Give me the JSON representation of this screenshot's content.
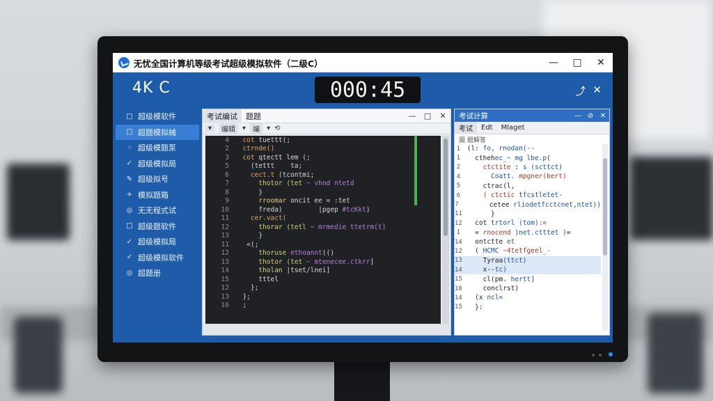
{
  "window": {
    "title": "无忧全国计算机等级考试超级模拟软件（二级C）",
    "controls": {
      "minimize": "—",
      "maximize": "□",
      "close": "✕"
    }
  },
  "header": {
    "level": "4K C",
    "timer": "000:45",
    "icons": {
      "upload": "⤴",
      "close": "✕"
    }
  },
  "sidebar": {
    "items": [
      {
        "label": "超级模软件",
        "icon": "□"
      },
      {
        "label": "超题模拟械",
        "icon": "□"
      },
      {
        "label": "超级模题泵",
        "icon": "⁘"
      },
      {
        "label": "超级模拟局",
        "icon": "✓"
      },
      {
        "label": "超级拟号",
        "icon": "✎"
      },
      {
        "label": "模拟题箱",
        "icon": "+"
      },
      {
        "label": "无无程式试",
        "icon": "◎"
      },
      {
        "label": "超级题软件",
        "icon": "□"
      },
      {
        "label": "超级模拟局",
        "icon": "✓"
      },
      {
        "label": "超级模拟软件",
        "icon": "✓"
      },
      {
        "label": "超题册",
        "icon": "◎"
      }
    ]
  },
  "editor": {
    "tabs": [
      "考试编试",
      "题题"
    ],
    "controls": {
      "minimize": "—",
      "maximize": "□",
      "close": "✕"
    },
    "toolbar": [
      "▾",
      "编辑",
      "▾",
      "编",
      "▾",
      "⟲"
    ],
    "lines": [
      {
        "n": "4",
        "segs": [
          {
            "c": "c-kw",
            "t": "  cot"
          },
          {
            "c": "c-plain",
            "t": " tuettt(;"
          }
        ]
      },
      {
        "n": "2",
        "segs": [
          {
            "c": "c-kw",
            "t": "  ctrnde()"
          }
        ]
      },
      {
        "n": "3",
        "segs": [
          {
            "c": "c-kw",
            "t": "  cot"
          },
          {
            "c": "c-plain",
            "t": " qtectt lem (;"
          }
        ]
      },
      {
        "n": "5",
        "segs": [
          {
            "c": "c-plain",
            "t": "    (tettt    ta;"
          }
        ]
      },
      {
        "n": "6",
        "segs": [
          {
            "c": "c-kw",
            "t": "    cect.t"
          },
          {
            "c": "c-plain",
            "t": " (tcontmi;"
          }
        ]
      },
      {
        "n": "7",
        "segs": [
          {
            "c": "c-fn",
            "t": "      thotor (tet"
          },
          {
            "c": "c-str",
            "t": " ~ vhnd ntetd"
          }
        ]
      },
      {
        "n": "8",
        "segs": [
          {
            "c": "c-plain",
            "t": "      }"
          }
        ]
      },
      {
        "n": "9",
        "segs": [
          {
            "c": "c-fn",
            "t": "      rroomar"
          },
          {
            "c": "c-plain",
            "t": " oncit ee = :tet"
          }
        ]
      },
      {
        "n": "10",
        "segs": [
          {
            "c": "c-plain",
            "t": "      freda)         |pgep "
          },
          {
            "c": "c-str",
            "t": "#tcKkt"
          },
          {
            "c": "c-plain",
            "t": ")"
          }
        ]
      },
      {
        "n": "11",
        "segs": [
          {
            "c": "c-kw",
            "t": "    cer.vact("
          }
        ]
      },
      {
        "n": "12",
        "segs": [
          {
            "c": "c-fn",
            "t": "      thorar (tetl"
          },
          {
            "c": "c-str",
            "t": " ~ mrmedie ttetrm(t]"
          }
        ]
      },
      {
        "n": "13",
        "segs": [
          {
            "c": "c-plain",
            "t": "      }"
          }
        ]
      },
      {
        "n": "11",
        "segs": [
          {
            "c": "c-plain",
            "t": "   <(;"
          }
        ]
      },
      {
        "n": "12",
        "segs": [
          {
            "c": "c-fn",
            "t": "      thoruse"
          },
          {
            "c": "c-str",
            "t": " ethoannt"
          },
          {
            "c": "c-plain",
            "t": "(()"
          }
        ]
      },
      {
        "n": "13",
        "segs": [
          {
            "c": "c-fn",
            "t": "      thotor (tet"
          },
          {
            "c": "c-str",
            "t": " ~ mtenecee.ctkrr"
          },
          {
            "c": "c-plain",
            "t": "]"
          }
        ]
      },
      {
        "n": "14",
        "segs": [
          {
            "c": "c-fn",
            "t": "      tholan"
          },
          {
            "c": "c-plain",
            "t": " |tset/lnei]"
          }
        ]
      },
      {
        "n": "15",
        "segs": [
          {
            "c": "c-plain",
            "t": "      tttel"
          }
        ]
      },
      {
        "n": "12",
        "segs": [
          {
            "c": "c-plain",
            "t": "    };"
          }
        ]
      },
      {
        "n": "13",
        "segs": [
          {
            "c": "c-plain",
            "t": "  };"
          }
        ]
      },
      {
        "n": "16",
        "segs": [
          {
            "c": "c-plain",
            "t": "  ;"
          }
        ]
      }
    ]
  },
  "answer_pane": {
    "title": "考试计算",
    "controls": {
      "minimize": "—",
      "maximize": "⊘",
      "close": "✕"
    },
    "tabs": [
      "考试",
      "Edt",
      "Mlaget"
    ],
    "subheader": "国 题解答",
    "lines": [
      {
        "n": "1",
        "hl": false,
        "segs": [
          {
            "c": "r-dark",
            "t": " (l:"
          },
          {
            "c": "r-blue",
            "t": " fo, rnodan(--"
          }
        ]
      },
      {
        "n": "1",
        "hl": false,
        "segs": [
          {
            "c": "r-dark",
            "t": "   ctheh"
          },
          {
            "c": "r-blue",
            "t": "ec_~ mg lbe.p"
          },
          {
            "c": "r-dark",
            "t": "("
          }
        ]
      },
      {
        "n": "2",
        "hl": false,
        "segs": [
          {
            "c": "r-red",
            "t": "     ctctite"
          },
          {
            "c": "r-dark",
            "t": " : "
          },
          {
            "c": "r-blue",
            "t": "s (scttct)"
          }
        ]
      },
      {
        "n": "4",
        "hl": false,
        "segs": [
          {
            "c": "r-blue",
            "t": "       Coatt."
          },
          {
            "c": "r-red",
            "t": " mpgner(bert)"
          }
        ]
      },
      {
        "n": "5",
        "hl": false,
        "segs": [
          {
            "c": "r-dark",
            "t": "     ctrac(l,"
          }
        ]
      },
      {
        "n": "6",
        "hl": false,
        "segs": [
          {
            "c": "r-red",
            "t": "     ( ctctic"
          },
          {
            "c": "r-blue",
            "t": " tfcstletet-"
          }
        ]
      },
      {
        "n": "7",
        "hl": false,
        "segs": [
          {
            "c": "r-dark",
            "t": "       cetee"
          },
          {
            "c": "r-blue",
            "t": " rliodetfcctcnet,ntet))"
          }
        ]
      },
      {
        "n": "11",
        "hl": false,
        "segs": [
          {
            "c": "r-dark",
            "t": "       }"
          }
        ]
      },
      {
        "n": "12",
        "hl": false,
        "segs": [
          {
            "c": "r-dark",
            "t": "   cot"
          },
          {
            "c": "r-blue",
            "t": " trtorl (tom)"
          },
          {
            "c": "r-red",
            "t": ":="
          }
        ]
      },
      {
        "n": "1",
        "hl": false,
        "segs": [
          {
            "c": "r-dark",
            "t": "   ="
          },
          {
            "c": "r-red",
            "t": " rnocend"
          },
          {
            "c": "r-blue",
            "t": " )net.ctttet )"
          },
          {
            "c": "r-dark",
            "t": "="
          }
        ]
      },
      {
        "n": "14",
        "hl": false,
        "segs": [
          {
            "c": "r-dark",
            "t": "   ontctte"
          },
          {
            "c": "r-blue",
            "t": " et"
          }
        ]
      },
      {
        "n": "12",
        "hl": false,
        "segs": [
          {
            "c": "r-dark",
            "t": "   ( "
          },
          {
            "c": "r-blue",
            "t": "HCMC "
          },
          {
            "c": "r-red",
            "t": "~4tetfgeel_-"
          }
        ]
      },
      {
        "n": "13",
        "hl": true,
        "segs": [
          {
            "c": "r-dark",
            "t": "     Tyraa"
          },
          {
            "c": "r-blue",
            "t": "(ttct)"
          }
        ]
      },
      {
        "n": "14",
        "hl": true,
        "segs": [
          {
            "c": "r-dark",
            "t": "     x--"
          },
          {
            "c": "r-blue",
            "t": "tc)"
          }
        ]
      },
      {
        "n": "15",
        "hl": false,
        "segs": [
          {
            "c": "r-dark",
            "t": "     cl(pm."
          },
          {
            "c": "r-blue",
            "t": " hertt]"
          }
        ]
      },
      {
        "n": "10",
        "hl": false,
        "segs": [
          {
            "c": "r-dark",
            "t": "     conclrst)"
          }
        ]
      },
      {
        "n": "14",
        "hl": false,
        "segs": [
          {
            "c": "r-dark",
            "t": "   (x"
          },
          {
            "c": "r-blue",
            "t": " ncl="
          }
        ]
      },
      {
        "n": "15",
        "hl": false,
        "segs": [
          {
            "c": "r-dark",
            "t": "   }:"
          }
        ]
      }
    ]
  }
}
